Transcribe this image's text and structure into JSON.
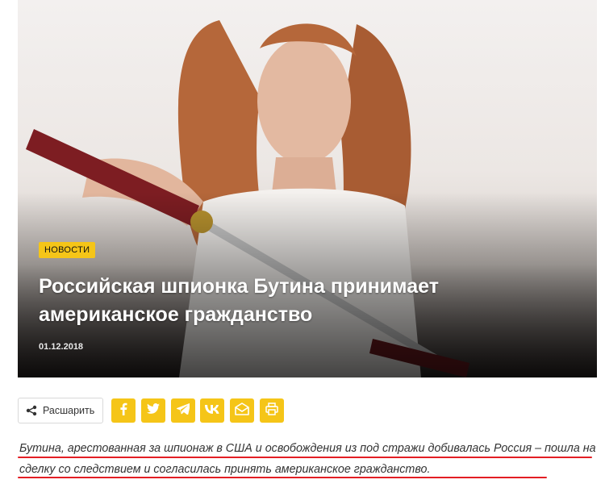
{
  "article": {
    "category": "Новости",
    "title": "Российская шпионка Бутина принимает американское гражданство",
    "date": "01.12.2018",
    "lead": "Бутина, арестованная за шпионаж в США и освобождения из под стражи добивалась Россия – пошла на сделку со следствием и согласилась принять американское гражданство."
  },
  "share": {
    "label": "Расшарить",
    "buttons": [
      {
        "name": "facebook",
        "icon": "facebook-icon"
      },
      {
        "name": "twitter",
        "icon": "twitter-icon"
      },
      {
        "name": "telegram",
        "icon": "telegram-icon"
      },
      {
        "name": "vk",
        "icon": "vk-icon"
      },
      {
        "name": "email",
        "icon": "mail-icon"
      },
      {
        "name": "print",
        "icon": "printer-icon"
      }
    ]
  },
  "colors": {
    "accent": "#f5c518",
    "underline": "#e31e24",
    "text": "#333333"
  }
}
